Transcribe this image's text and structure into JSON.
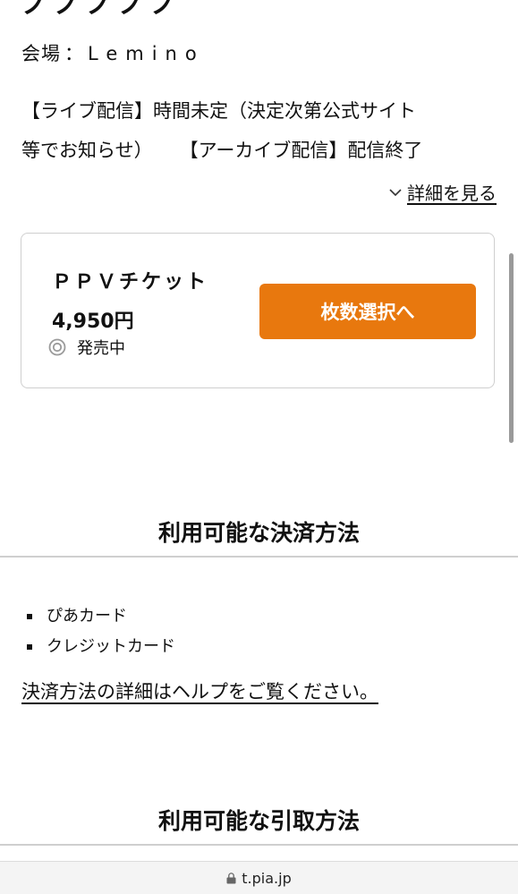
{
  "header": {
    "cut_title": "ノノノノノ"
  },
  "event": {
    "venue_label": "会場",
    "venue_separator": "：",
    "venue_name": "Lemino",
    "description_line1": "【ライブ配信】時間未定（決定次第公式サイト",
    "description_line2a": "等でお知らせ）",
    "description_line2b": "【アーカイブ配信】配信終了",
    "details_link": "詳細を見る"
  },
  "ticket": {
    "name": "ＰＰＶチケット",
    "price": "4,950円",
    "status": "発売中",
    "select_button": "枚数選択へ"
  },
  "payment": {
    "section_title": "利用可能な決済方法",
    "methods": [
      "ぴあカード",
      "クレジットカード"
    ],
    "help_link": "決済方法の詳細はヘルプをご覧ください。"
  },
  "pickup": {
    "section_title": "利用可能な引取方法"
  },
  "browser": {
    "url": "t.pia.jp"
  },
  "colors": {
    "accent": "#e8780e",
    "divider": "#cfcfcf"
  },
  "icons": {
    "details_chevron": "chevron-down-icon",
    "status": "double-circle-icon",
    "url_lock": "lock-icon"
  }
}
